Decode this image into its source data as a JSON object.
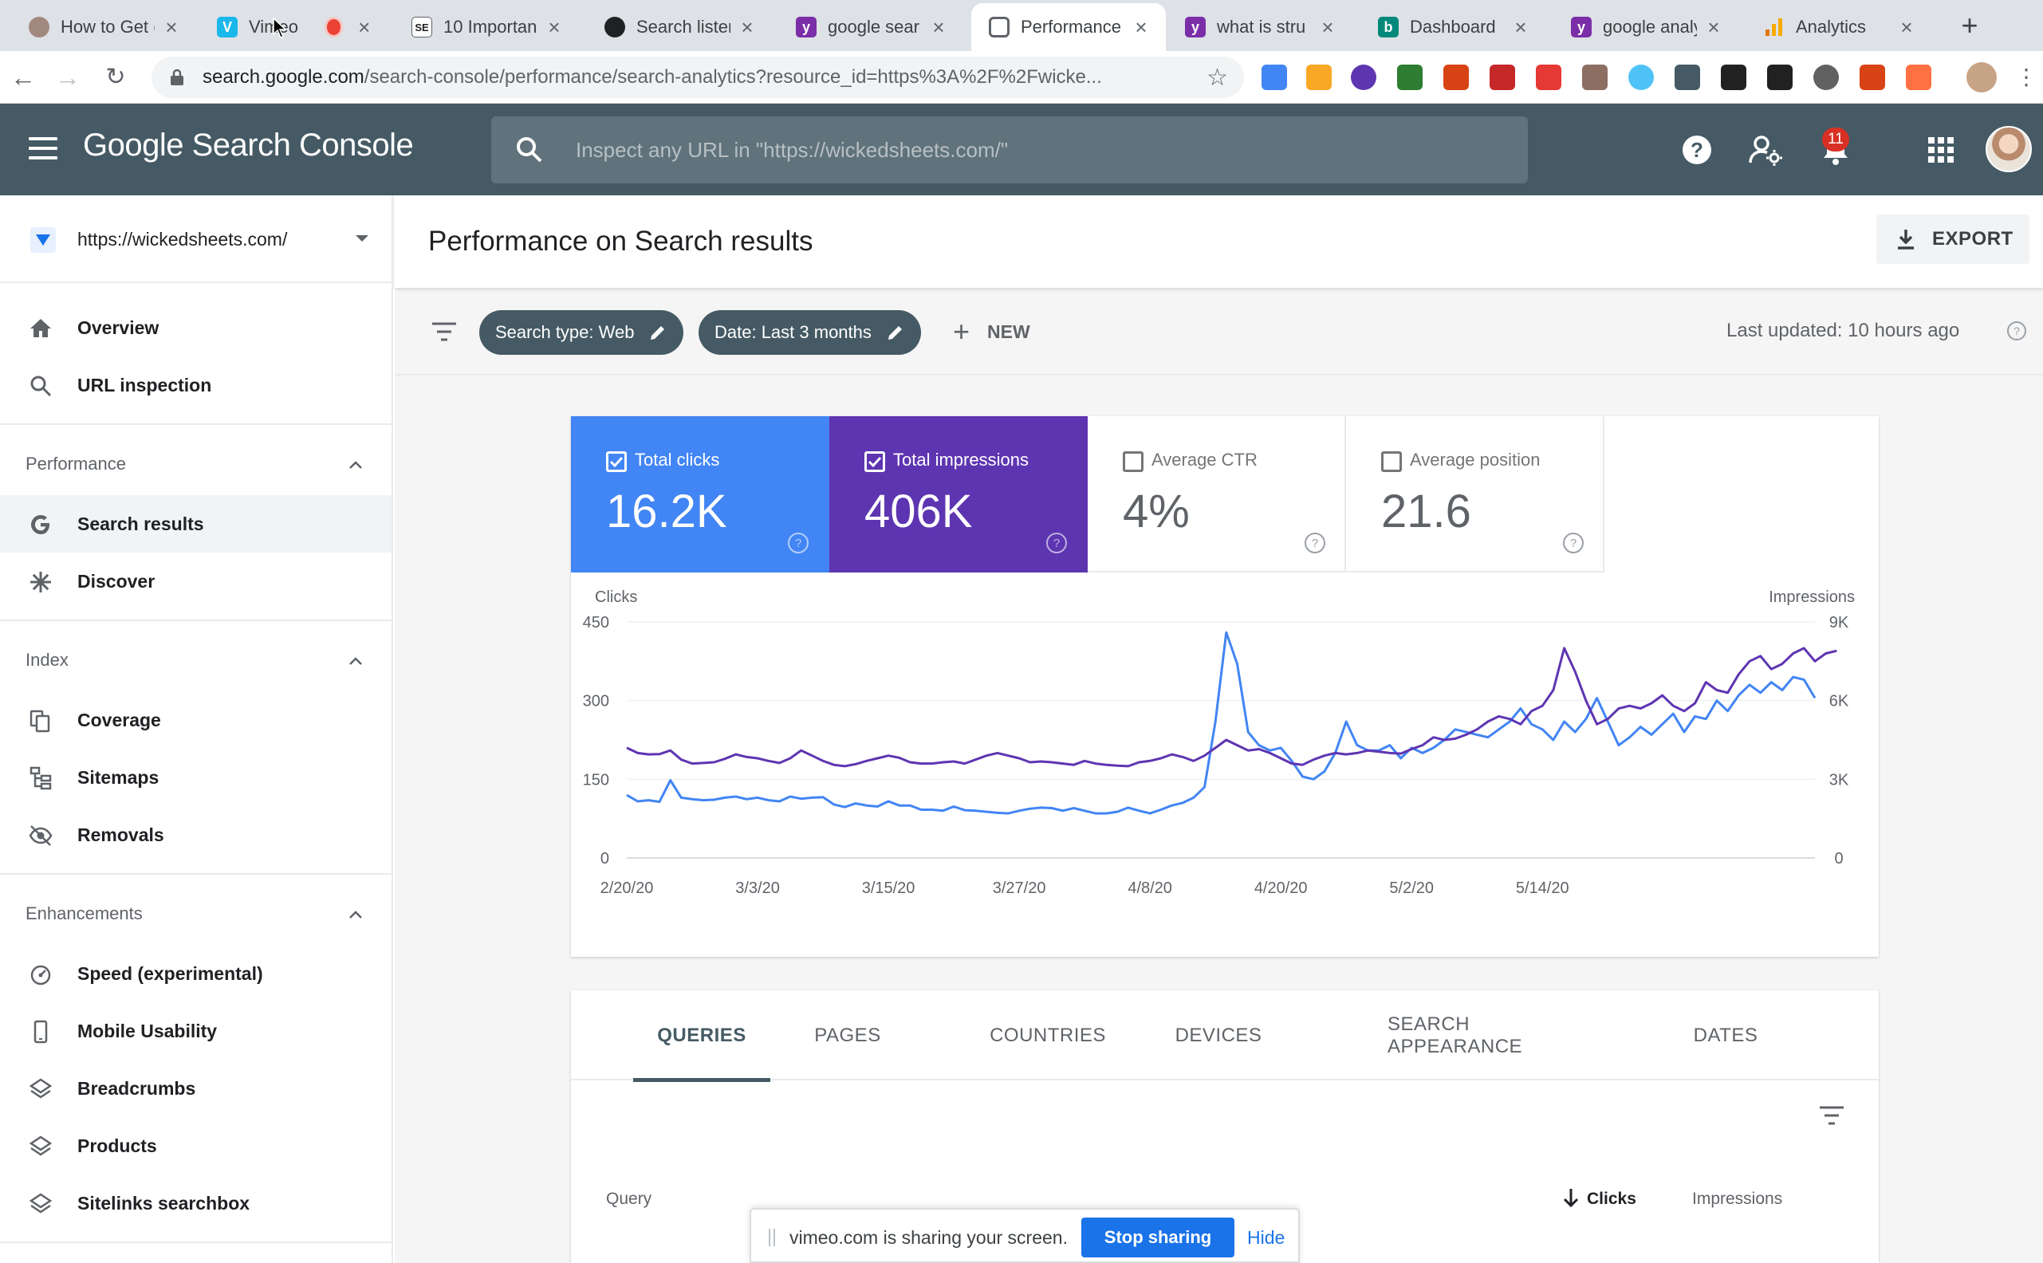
{
  "browser": {
    "tabs": [
      {
        "label": "How to Get (",
        "favicon_color": "#a1887f",
        "favicon_char": ""
      },
      {
        "label": "Vimeo",
        "favicon_color": "#1ab7ea",
        "favicon_char": "V"
      },
      {
        "label": "10 Importan",
        "favicon_color": "#202124",
        "favicon_char": "SE"
      },
      {
        "label": "Search lister",
        "favicon_color": "#202124",
        "favicon_char": ""
      },
      {
        "label": "google sear",
        "favicon_color": "#7b2ea8",
        "favicon_char": "Y"
      },
      {
        "label": "Performance",
        "favicon_color": "#5f6368",
        "favicon_char": ""
      },
      {
        "label": "what is stru",
        "favicon_color": "#7b2ea8",
        "favicon_char": "Y"
      },
      {
        "label": "Dashboard",
        "favicon_color": "#00897b",
        "favicon_char": "b"
      },
      {
        "label": "google analy",
        "favicon_color": "#7b2ea8",
        "favicon_char": "Y"
      },
      {
        "label": "Analytics",
        "favicon_color": "#f9ab00",
        "favicon_char": ""
      }
    ],
    "active_tab": 5,
    "url_host": "search.google.com",
    "url_path": "/search-console/performance/search-analytics?resource_id=https%3A%2F%2Fwicke..."
  },
  "header": {
    "app_name": "Google Search Console",
    "search_placeholder": "Inspect any URL in \"https://wickedsheets.com/\"",
    "notification_count": "11"
  },
  "sidebar": {
    "property_url": "https://wickedsheets.com/",
    "top_items": [
      {
        "label": "Overview",
        "icon": "home-icon"
      },
      {
        "label": "URL inspection",
        "icon": "search-icon"
      }
    ],
    "performance": {
      "title": "Performance",
      "items": [
        {
          "label": "Search results",
          "icon": "google-g-icon",
          "active": true
        },
        {
          "label": "Discover",
          "icon": "asterisk-icon"
        }
      ]
    },
    "index": {
      "title": "Index",
      "items": [
        {
          "label": "Coverage",
          "icon": "file-copy-icon"
        },
        {
          "label": "Sitemaps",
          "icon": "sitemap-icon"
        },
        {
          "label": "Removals",
          "icon": "eye-off-icon"
        }
      ]
    },
    "enhancements": {
      "title": "Enhancements",
      "items": [
        {
          "label": "Speed (experimental)",
          "icon": "speedometer-icon"
        },
        {
          "label": "Mobile Usability",
          "icon": "phone-icon"
        },
        {
          "label": "Breadcrumbs",
          "icon": "layers-icon"
        },
        {
          "label": "Products",
          "icon": "layers-icon"
        },
        {
          "label": "Sitelinks searchbox",
          "icon": "layers-icon"
        }
      ]
    }
  },
  "main": {
    "title": "Performance on Search results",
    "export_label": "EXPORT",
    "filters": [
      {
        "label": "Search type: Web"
      },
      {
        "label": "Date: Last 3 months"
      }
    ],
    "new_label": "NEW",
    "last_updated": "Last updated: 10 hours ago"
  },
  "metrics": [
    {
      "label": "Total clicks",
      "value": "16.2K",
      "checked": true,
      "color": "#4285f4"
    },
    {
      "label": "Total impressions",
      "value": "406K",
      "checked": true,
      "color": "#5e35b1"
    },
    {
      "label": "Average CTR",
      "value": "4%",
      "checked": false,
      "color": "#ffffff"
    },
    {
      "label": "Average position",
      "value": "21.6",
      "checked": false,
      "color": "#ffffff"
    }
  ],
  "chart_data": {
    "type": "line",
    "ylabel_left": "Clicks",
    "ylabel_right": "Impressions",
    "y_left_ticks": [
      "0",
      "150",
      "300",
      "450"
    ],
    "y_right_ticks": [
      "0",
      "3K",
      "6K",
      "9K"
    ],
    "y_left_range": [
      0,
      450
    ],
    "y_right_range": [
      0,
      9000
    ],
    "x_tick_labels": [
      "2/20/20",
      "3/3/20",
      "3/15/20",
      "3/27/20",
      "4/8/20",
      "4/20/20",
      "5/2/20",
      "5/14/20"
    ],
    "x_start": "2020-02-20",
    "grid": true,
    "series": [
      {
        "name": "Clicks",
        "axis": "left",
        "color": "#4285f4",
        "values": [
          120,
          108,
          110,
          107,
          148,
          115,
          112,
          110,
          111,
          115,
          117,
          112,
          115,
          110,
          108,
          117,
          113,
          115,
          116,
          102,
          97,
          104,
          100,
          98,
          108,
          100,
          100,
          92,
          92,
          90,
          98,
          91,
          90,
          88,
          86,
          85,
          90,
          94,
          96,
          95,
          90,
          95,
          90,
          85,
          85,
          88,
          96,
          90,
          85,
          92,
          100,
          105,
          115,
          135,
          260,
          430,
          370,
          240,
          215,
          205,
          210,
          185,
          155,
          150,
          165,
          200,
          260,
          215,
          205,
          205,
          215,
          190,
          210,
          200,
          210,
          225,
          245,
          240,
          235,
          230,
          245,
          260,
          285,
          255,
          245,
          225,
          260,
          240,
          265,
          305,
          260,
          215,
          230,
          250,
          235,
          255,
          275,
          240,
          270,
          265,
          300,
          280,
          310,
          330,
          315,
          335,
          320,
          345,
          340,
          305
        ]
      },
      {
        "name": "Impressions",
        "axis": "right",
        "color": "#5e35b1",
        "values": [
          4200,
          4000,
          3950,
          3960,
          4100,
          3750,
          3600,
          3620,
          3650,
          3780,
          3950,
          3850,
          3800,
          3700,
          3620,
          3800,
          4100,
          3900,
          3700,
          3550,
          3500,
          3580,
          3700,
          3800,
          3900,
          3820,
          3650,
          3600,
          3600,
          3650,
          3680,
          3600,
          3750,
          3900,
          4000,
          3900,
          3800,
          3650,
          3680,
          3650,
          3600,
          3550,
          3700,
          3600,
          3550,
          3520,
          3500,
          3650,
          3700,
          3800,
          3950,
          3850,
          3700,
          3900,
          4200,
          4500,
          4300,
          4100,
          4150,
          4000,
          3800,
          3600,
          3550,
          3750,
          3900,
          4000,
          3950,
          4000,
          4100,
          4050,
          4000,
          3980,
          4150,
          4300,
          4600,
          4500,
          4550,
          4700,
          4900,
          5200,
          5400,
          5300,
          5100,
          5600,
          5800,
          6400,
          8000,
          7100,
          6000,
          5100,
          5300,
          5700,
          5800,
          5700,
          5900,
          6200,
          5800,
          5600,
          5900,
          6700,
          6400,
          6300,
          7000,
          7500,
          7700,
          7200,
          7400,
          7800,
          8000,
          7500,
          7800,
          7900
        ]
      }
    ]
  },
  "tabs": [
    "QUERIES",
    "PAGES",
    "COUNTRIES",
    "DEVICES",
    "SEARCH APPEARANCE",
    "DATES"
  ],
  "table": {
    "col_query": "Query",
    "col_clicks": "Clicks",
    "col_impressions": "Impressions"
  },
  "sharebar": {
    "message": "vimeo.com is sharing your screen.",
    "stop_label": "Stop sharing",
    "hide_label": "Hide"
  }
}
